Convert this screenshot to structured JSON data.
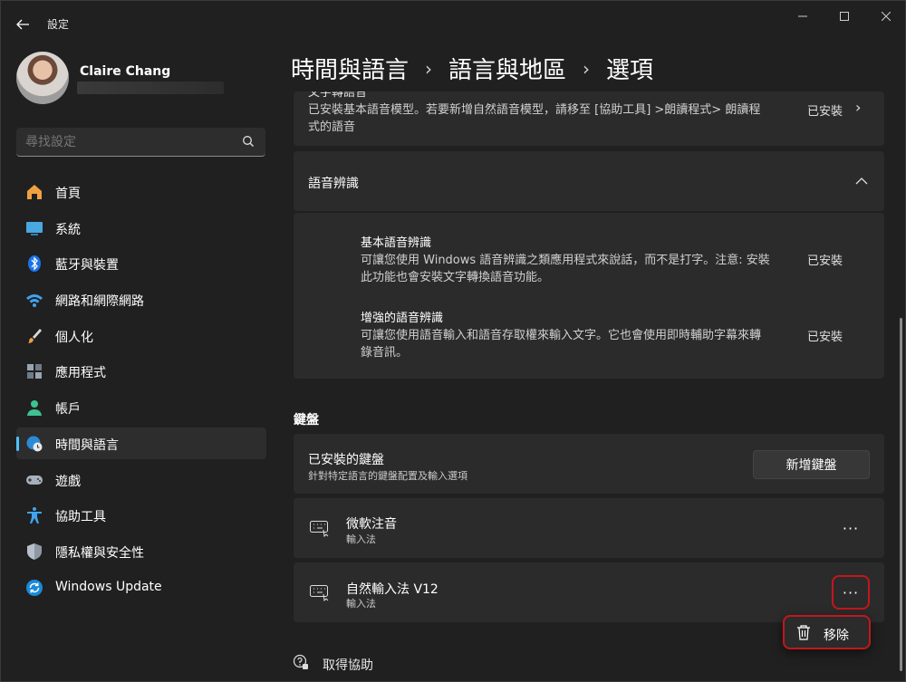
{
  "app": {
    "title": "設定"
  },
  "profile": {
    "name": "Claire Chang"
  },
  "search": {
    "placeholder": "尋找設定"
  },
  "sidebar": {
    "items": [
      {
        "label": "首頁",
        "icon": "home-icon"
      },
      {
        "label": "系統",
        "icon": "system-icon"
      },
      {
        "label": "藍牙與裝置",
        "icon": "bluetooth-icon"
      },
      {
        "label": "網路和網際網路",
        "icon": "wifi-icon"
      },
      {
        "label": "個人化",
        "icon": "brush-icon"
      },
      {
        "label": "應用程式",
        "icon": "apps-icon"
      },
      {
        "label": "帳戶",
        "icon": "account-icon"
      },
      {
        "label": "時間與語言",
        "icon": "time-language-icon",
        "selected": true
      },
      {
        "label": "遊戲",
        "icon": "gamepad-icon"
      },
      {
        "label": "協助工具",
        "icon": "accessibility-icon"
      },
      {
        "label": "隱私權與安全性",
        "icon": "shield-icon"
      },
      {
        "label": "Windows Update",
        "icon": "update-icon"
      }
    ]
  },
  "breadcrumb": {
    "level1": "時間與語言",
    "level2": "語言與地區",
    "level3": "選項"
  },
  "tts_card": {
    "title_partial": "文字轉語音",
    "desc_line1": "已安裝基本語音模型。若要新增自然語音模型，請移至 [協助工具] >朗讀程式> 朗讀程",
    "desc_line2": "式的語音",
    "status": "已安裝"
  },
  "speech_recognition": {
    "title": "語音辨識",
    "items": [
      {
        "title": "基本語音辨識",
        "desc_line1": "可讓您使用 Windows 語音辨識之類應用程式來說話，而不是打字。注意: 安裝",
        "desc_line2": "此功能也會安裝文字轉換語音功能。",
        "status": "已安裝"
      },
      {
        "title": "增強的語音辨識",
        "desc_line1": "可讓您使用語音輸入和語音存取權來輸入文字。它也會使用即時輔助字幕來轉",
        "desc_line2": "錄音訊。",
        "status": "已安裝"
      }
    ]
  },
  "keyboard": {
    "section_title": "鍵盤",
    "installed_title": "已安裝的鍵盤",
    "installed_desc": "針對特定語言的鍵盤配置及輸入選項",
    "add_button": "新增鍵盤",
    "items": [
      {
        "name": "微軟注音",
        "type": "輸入法"
      },
      {
        "name": "自然輸入法 V12",
        "type": "輸入法"
      }
    ],
    "more_label": "···"
  },
  "context_menu": {
    "remove_label": "移除"
  },
  "help": {
    "label": "取得協助"
  },
  "colors": {
    "accent": "#4cc2ff",
    "highlight": "#c4161c",
    "background": "#202020",
    "card": "#2b2b2b"
  }
}
